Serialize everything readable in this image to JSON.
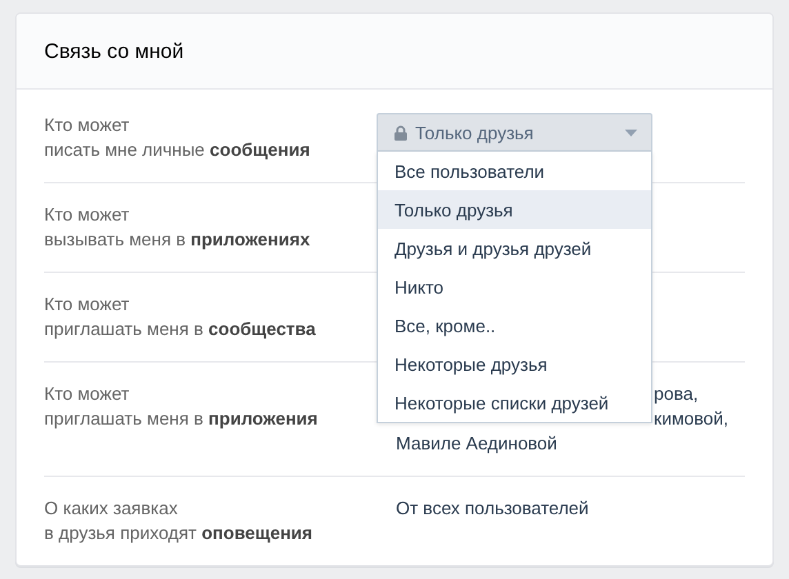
{
  "header": {
    "title": "Связь со мной"
  },
  "rows": [
    {
      "label": "Кто может\nписать мне личные **сообщения**",
      "kind": "select",
      "select": {
        "value": "Только друзья",
        "locked": true,
        "expanded": true,
        "options": [
          {
            "label": "Все пользователи",
            "selected": false
          },
          {
            "label": "Только друзья",
            "selected": true
          },
          {
            "label": "Друзья и друзья друзей",
            "selected": false
          },
          {
            "label": "Никто",
            "selected": false
          },
          {
            "label": "Все, кроме..",
            "selected": false
          },
          {
            "label": "Некоторые друзья",
            "selected": false
          },
          {
            "label": "Некоторые списки друзей",
            "selected": false
          }
        ]
      }
    },
    {
      "label": "Кто может\nвызывать меня в **приложениях**",
      "kind": "hidden"
    },
    {
      "label": "Кто может\nприглашать меня в **сообщества**",
      "kind": "hidden"
    },
    {
      "label": "Кто может\nприглашать меня в **приложения**",
      "kind": "text",
      "lines": [
        {
          "text": "рова,",
          "covered": true
        },
        {
          "text": "кимовой,",
          "covered": true
        },
        {
          "text": "Мавиле Аединовой",
          "covered": false
        }
      ]
    },
    {
      "label": "О каких заявках\nв друзья приходят **оповещения**",
      "kind": "text",
      "lines": [
        {
          "text": "От всех пользователей",
          "covered": false
        }
      ]
    }
  ]
}
